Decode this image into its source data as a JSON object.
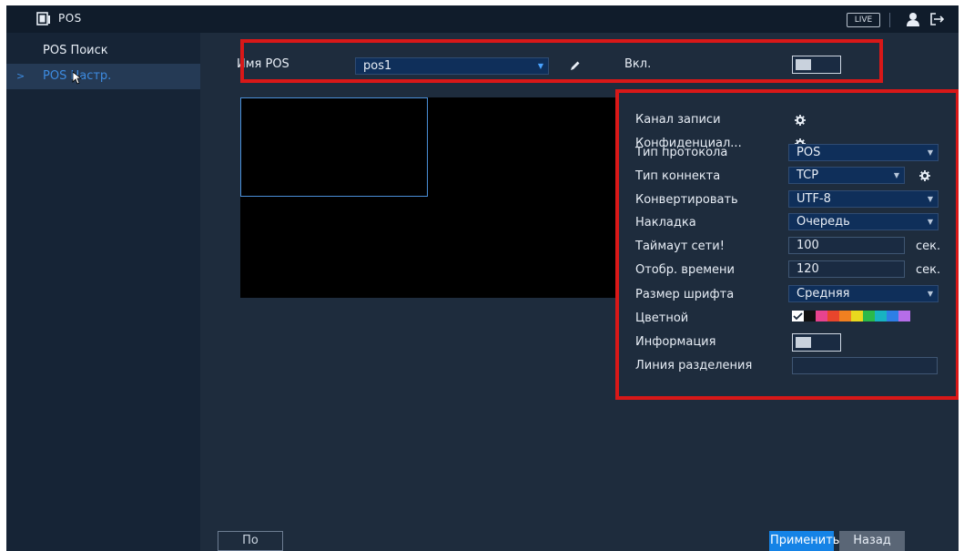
{
  "titlebar": {
    "title": "POS",
    "live_label": "LIVE"
  },
  "sidebar": {
    "items": [
      {
        "label": "POS Поиск"
      },
      {
        "label": "POS Настр."
      }
    ],
    "chevron": ">"
  },
  "pos_row": {
    "name_label": "Имя POS",
    "name_value": "pos1",
    "enable_label": "Вкл.",
    "enabled": false
  },
  "settings": {
    "record_channel": "Канал записи",
    "privacy": "Конфиденциал...",
    "protocol_label": "Тип протокола",
    "protocol_value": "POS",
    "connect_label": "Тип коннекта",
    "connect_value": "TCP",
    "convert_label": "Конвертировать",
    "convert_value": "UTF-8",
    "overlay_label": "Накладка",
    "overlay_value": "Очередь",
    "timeout_label": "Таймаут сети!",
    "timeout_value": "100",
    "timeout_unit": "сек.",
    "time_display_label": "Отобр. времени",
    "time_display_value": "120",
    "time_display_unit": "сек.",
    "font_size_label": "Размер шрифта",
    "font_size_value": "Средняя",
    "color_label": "Цветной",
    "info_label": "Информация",
    "info_enabled": false,
    "divider_label": "Линия разделения",
    "divider_value": ""
  },
  "color_swatches": [
    "#ffffff",
    "#111111",
    "#e8438e",
    "#e8452c",
    "#f08020",
    "#e8d81e",
    "#2bb94a",
    "#18b3c2",
    "#2e7fe6",
    "#b56de8"
  ],
  "buttons": {
    "default": "По умолч...",
    "apply": "Применить",
    "back": "Назад"
  },
  "colors": {
    "highlight": "#d81818",
    "accent": "#1583e6"
  }
}
